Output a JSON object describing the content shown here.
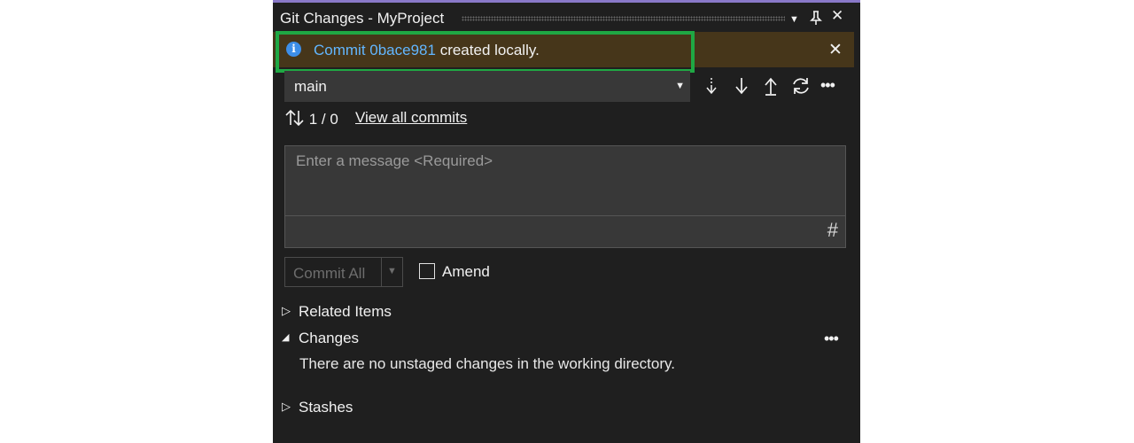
{
  "window": {
    "title": "Git Changes - MyProject"
  },
  "icons": {
    "dropdown": "▼",
    "pin": "pin-icon",
    "close": "✕"
  },
  "notification": {
    "link_text": "Commit 0bace981",
    "rest_text": " created locally.",
    "close": "✕",
    "colors": {
      "background": "#46361a",
      "link": "#62b6ff",
      "highlight": "#1fa844"
    }
  },
  "branch": {
    "name": "main"
  },
  "commits": {
    "counts": "1 / 0",
    "view_all": "View all commits"
  },
  "message": {
    "placeholder": "Enter a message <Required>"
  },
  "commit_button": {
    "label": "Commit All"
  },
  "amend": {
    "label": "Amend",
    "checked": false
  },
  "sections": {
    "related_items": "Related Items",
    "changes": "Changes",
    "changes_empty": "There are no unstaged changes in the working directory.",
    "stashes": "Stashes"
  }
}
